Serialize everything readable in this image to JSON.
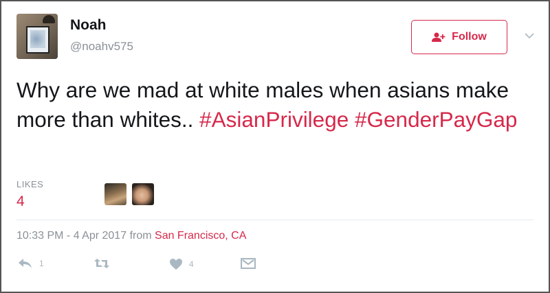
{
  "user": {
    "name": "Noah",
    "handle": "@noahv575"
  },
  "follow_button": {
    "label": "Follow",
    "icon": "add-user-icon"
  },
  "tweet": {
    "segments": [
      {
        "text": "Why are we mad at white males when asians make more than whites.. ",
        "type": "text"
      },
      {
        "text": "#AsianPrivilege",
        "type": "hashtag"
      },
      {
        "text": " ",
        "type": "text"
      },
      {
        "text": "#GenderPayGap",
        "type": "hashtag"
      }
    ]
  },
  "likes": {
    "label": "LIKES",
    "count": "4"
  },
  "meta": {
    "timestamp": "10:33 PM - 4 Apr 2017",
    "from": "from",
    "location": "San Francisco, CA"
  },
  "actions": {
    "reply": {
      "icon": "reply-icon",
      "count": "1"
    },
    "retweet": {
      "icon": "retweet-icon",
      "count": ""
    },
    "like": {
      "icon": "heart-icon",
      "count": "4"
    },
    "dm": {
      "icon": "direct-message-icon",
      "count": ""
    }
  },
  "colors": {
    "accent": "#d6284a",
    "muted": "#8a9097",
    "icon_muted": "#aab8c2",
    "text": "#14171a"
  }
}
